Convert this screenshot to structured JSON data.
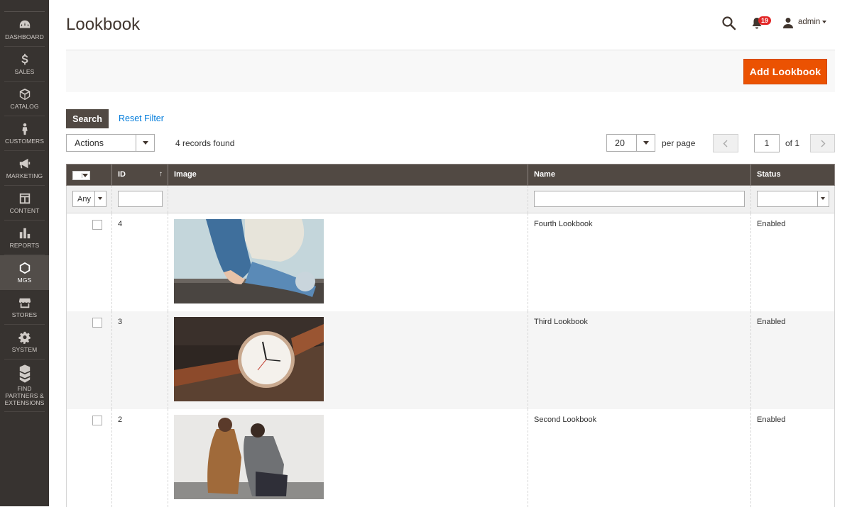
{
  "sidebar": {
    "items": [
      {
        "label": "DASHBOARD",
        "icon": "dashboard-icon"
      },
      {
        "label": "SALES",
        "icon": "dollar-icon"
      },
      {
        "label": "CATALOG",
        "icon": "cube-icon"
      },
      {
        "label": "CUSTOMERS",
        "icon": "person-icon"
      },
      {
        "label": "MARKETING",
        "icon": "megaphone-icon"
      },
      {
        "label": "CONTENT",
        "icon": "layout-icon"
      },
      {
        "label": "REPORTS",
        "icon": "bar-chart-icon"
      },
      {
        "label": "MGS",
        "icon": "hexagon-icon"
      },
      {
        "label": "STORES",
        "icon": "storefront-icon"
      },
      {
        "label": "SYSTEM",
        "icon": "gear-icon"
      },
      {
        "label": "FIND PARTNERS & EXTENSIONS",
        "icon": "boxes-icon"
      }
    ],
    "active": "MGS"
  },
  "header": {
    "title": "Lookbook",
    "notifications_count": "19",
    "user": "admin"
  },
  "action_bar": {
    "add_label": "Add Lookbook"
  },
  "toolbar": {
    "search_label": "Search",
    "reset_label": "Reset Filter",
    "actions_label": "Actions",
    "records_text": "4 records found",
    "per_page_value": "20",
    "per_page_label": "per page",
    "page_value": "1",
    "of_text": "of 1"
  },
  "grid": {
    "columns": [
      "ID",
      "Image",
      "Name",
      "Status"
    ],
    "filter_any": "Any",
    "rows": [
      {
        "id": "4",
        "name": "Fourth Lookbook",
        "status": "Enabled",
        "image": "jeans-sweater-photo"
      },
      {
        "id": "3",
        "name": "Third Lookbook",
        "status": "Enabled",
        "image": "watch-photo"
      },
      {
        "id": "2",
        "name": "Second Lookbook",
        "status": "Enabled",
        "image": "two-models-photo"
      }
    ]
  },
  "colors": {
    "sidebar_bg": "#373330",
    "accent": "#eb5202",
    "grid_header": "#514943",
    "link": "#007bdb"
  }
}
